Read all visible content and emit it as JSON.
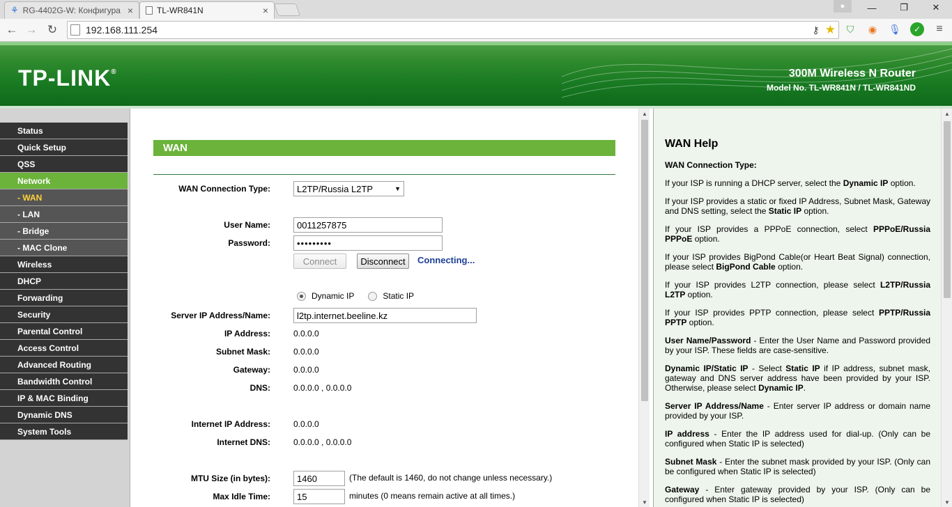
{
  "browser": {
    "tabs": [
      {
        "title": "RG-4402G-W: Конфигура",
        "active": false
      },
      {
        "title": "TL-WR841N",
        "active": true
      }
    ],
    "url": "192.168.111.254"
  },
  "banner": {
    "logo": "TP-LINK",
    "logo_mark": "®",
    "product": "300M Wireless N Router",
    "model": "Model No. TL-WR841N / TL-WR841ND"
  },
  "menu": [
    {
      "label": "Status",
      "type": "top"
    },
    {
      "label": "Quick Setup",
      "type": "top"
    },
    {
      "label": "QSS",
      "type": "top"
    },
    {
      "label": "Network",
      "type": "active"
    },
    {
      "label": "- WAN",
      "type": "sub-selected"
    },
    {
      "label": "- LAN",
      "type": "sub"
    },
    {
      "label": "- Bridge",
      "type": "sub"
    },
    {
      "label": "- MAC Clone",
      "type": "sub"
    },
    {
      "label": "Wireless",
      "type": "top"
    },
    {
      "label": "DHCP",
      "type": "top"
    },
    {
      "label": "Forwarding",
      "type": "top"
    },
    {
      "label": "Security",
      "type": "top"
    },
    {
      "label": "Parental Control",
      "type": "top"
    },
    {
      "label": "Access Control",
      "type": "top"
    },
    {
      "label": "Advanced Routing",
      "type": "top"
    },
    {
      "label": "Bandwidth Control",
      "type": "top"
    },
    {
      "label": "IP & MAC Binding",
      "type": "top"
    },
    {
      "label": "Dynamic DNS",
      "type": "top"
    },
    {
      "label": "System Tools",
      "type": "top"
    }
  ],
  "wan": {
    "title": "WAN",
    "conn_type_label": "WAN Connection Type:",
    "conn_type_value": "L2TP/Russia L2TP",
    "username_label": "User Name:",
    "username_value": "0011257875",
    "password_label": "Password:",
    "password_value": "•••••••••",
    "connect_label": "Connect",
    "disconnect_label": "Disconnect",
    "status": "Connecting...",
    "dynamic_ip_label": "Dynamic IP",
    "static_ip_label": "Static IP",
    "ip_mode_selected": "Dynamic IP",
    "server_label": "Server IP Address/Name:",
    "server_value": "l2tp.internet.beeline.kz",
    "ip_label": "IP Address:",
    "ip_value": "0.0.0.0",
    "mask_label": "Subnet Mask:",
    "mask_value": "0.0.0.0",
    "gateway_label": "Gateway:",
    "gateway_value": "0.0.0.0",
    "dns_label": "DNS:",
    "dns_value": "0.0.0.0 , 0.0.0.0",
    "internet_ip_label": "Internet IP Address:",
    "internet_ip_value": "0.0.0.0",
    "internet_dns_label": "Internet DNS:",
    "internet_dns_value": "0.0.0.0 , 0.0.0.0",
    "mtu_label": "MTU Size (in bytes):",
    "mtu_value": "1460",
    "mtu_note": "(The default is 1460, do not change unless necessary.)",
    "idle_label": "Max Idle Time:",
    "idle_value": "15",
    "idle_note": "minutes (0 means remain active at all times.)"
  },
  "help": {
    "title": "WAN Help",
    "subtitle": "WAN Connection Type:"
  },
  "colors": {
    "menu_active": "#6bb33a",
    "menu_dark": "#333333",
    "status_blue": "#1c3f94",
    "banner_green": "#187a22"
  }
}
